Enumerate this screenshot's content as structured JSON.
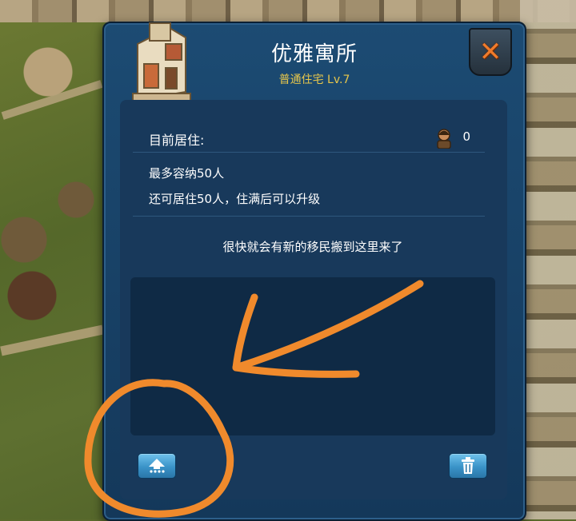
{
  "dialog": {
    "title": "优雅寓所",
    "subtitle": "普通住宅 Lv.7",
    "resident_label": "目前居住:",
    "resident_count": "0",
    "capacity_text": "最多容纳50人",
    "remaining_text": "还可居住50人，住满后可以升级",
    "message": "很快就会有新的移民搬到这里来了"
  },
  "icons": {
    "building": "house-building-icon",
    "close": "close-x-icon",
    "person": "person-avatar-icon",
    "upgrade": "upgrade-arrow-icon",
    "demolish": "trash-can-icon"
  },
  "colors": {
    "panel": "#18395b",
    "accent_gold": "#e7c64b",
    "close_orange": "#f07b2b",
    "button_blue": "#3a93c8",
    "annotation_orange": "#f08a2c"
  }
}
